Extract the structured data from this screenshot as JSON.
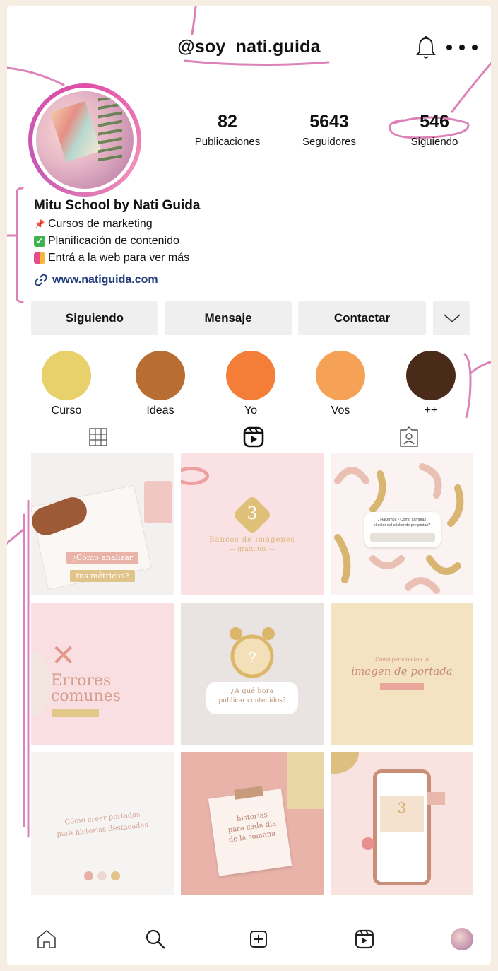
{
  "profile": {
    "username": "@soy_nati.guida",
    "stats": [
      {
        "value": "82",
        "label": "Publicaciones"
      },
      {
        "value": "5643",
        "label": "Seguidores"
      },
      {
        "value": "546",
        "label": "Siguiendo"
      }
    ],
    "name": "Mitu School by Nati Guida",
    "bio_lines": [
      {
        "icon": "pushpin-icon",
        "text": "Cursos de marketing"
      },
      {
        "icon": "checkmark-icon",
        "text": "Planificación de contenido"
      },
      {
        "icon": "shopping-bags-icon",
        "text": "Entrá a la web para ver más"
      }
    ],
    "website": "www.natiguida.com"
  },
  "actions": {
    "following_label": "Siguiendo",
    "message_label": "Mensaje",
    "contact_label": "Contactar"
  },
  "highlights": [
    {
      "label": "Curso",
      "color": "#e8d06a"
    },
    {
      "label": "Ideas",
      "color": "#b86e32"
    },
    {
      "label": "Yo",
      "color": "#f47d38"
    },
    {
      "label": "Vos",
      "color": "#f5a257"
    },
    {
      "label": "++",
      "color": "#4a2b1a"
    }
  ],
  "tabs": [
    "grid-icon",
    "reels-icon",
    "tagged-icon"
  ],
  "posts": [
    {
      "lines": [
        "¿Cómo analizar",
        "tus métricas?"
      ]
    },
    {
      "lines": [
        "3",
        "Bancos de imágenes",
        "— gratuitos —"
      ]
    },
    {
      "lines": [
        "¿Hacemos ¿Cómo cambiás",
        "el color del sticker de preguntas?"
      ]
    },
    {
      "lines": [
        "Errores",
        "comunes"
      ]
    },
    {
      "lines": [
        "¿A qué hora",
        "publicar contenidos?"
      ]
    },
    {
      "lines": [
        "Cómo personalizar la",
        "imagen de portada"
      ]
    },
    {
      "lines": [
        "Cómo crear portadas",
        "para historias destacadas"
      ]
    },
    {
      "lines": [
        "historias",
        "para cada día",
        "de la semana"
      ]
    },
    {
      "lines": [
        "3"
      ]
    }
  ],
  "bottom_nav": [
    "home-icon",
    "search-icon",
    "add-post-icon",
    "reels-icon",
    "profile-avatar"
  ],
  "colors": {
    "annotation": "#d876b0",
    "link": "#1f3b7a",
    "button_bg": "#efefef",
    "page_bg": "#f6ede3"
  }
}
